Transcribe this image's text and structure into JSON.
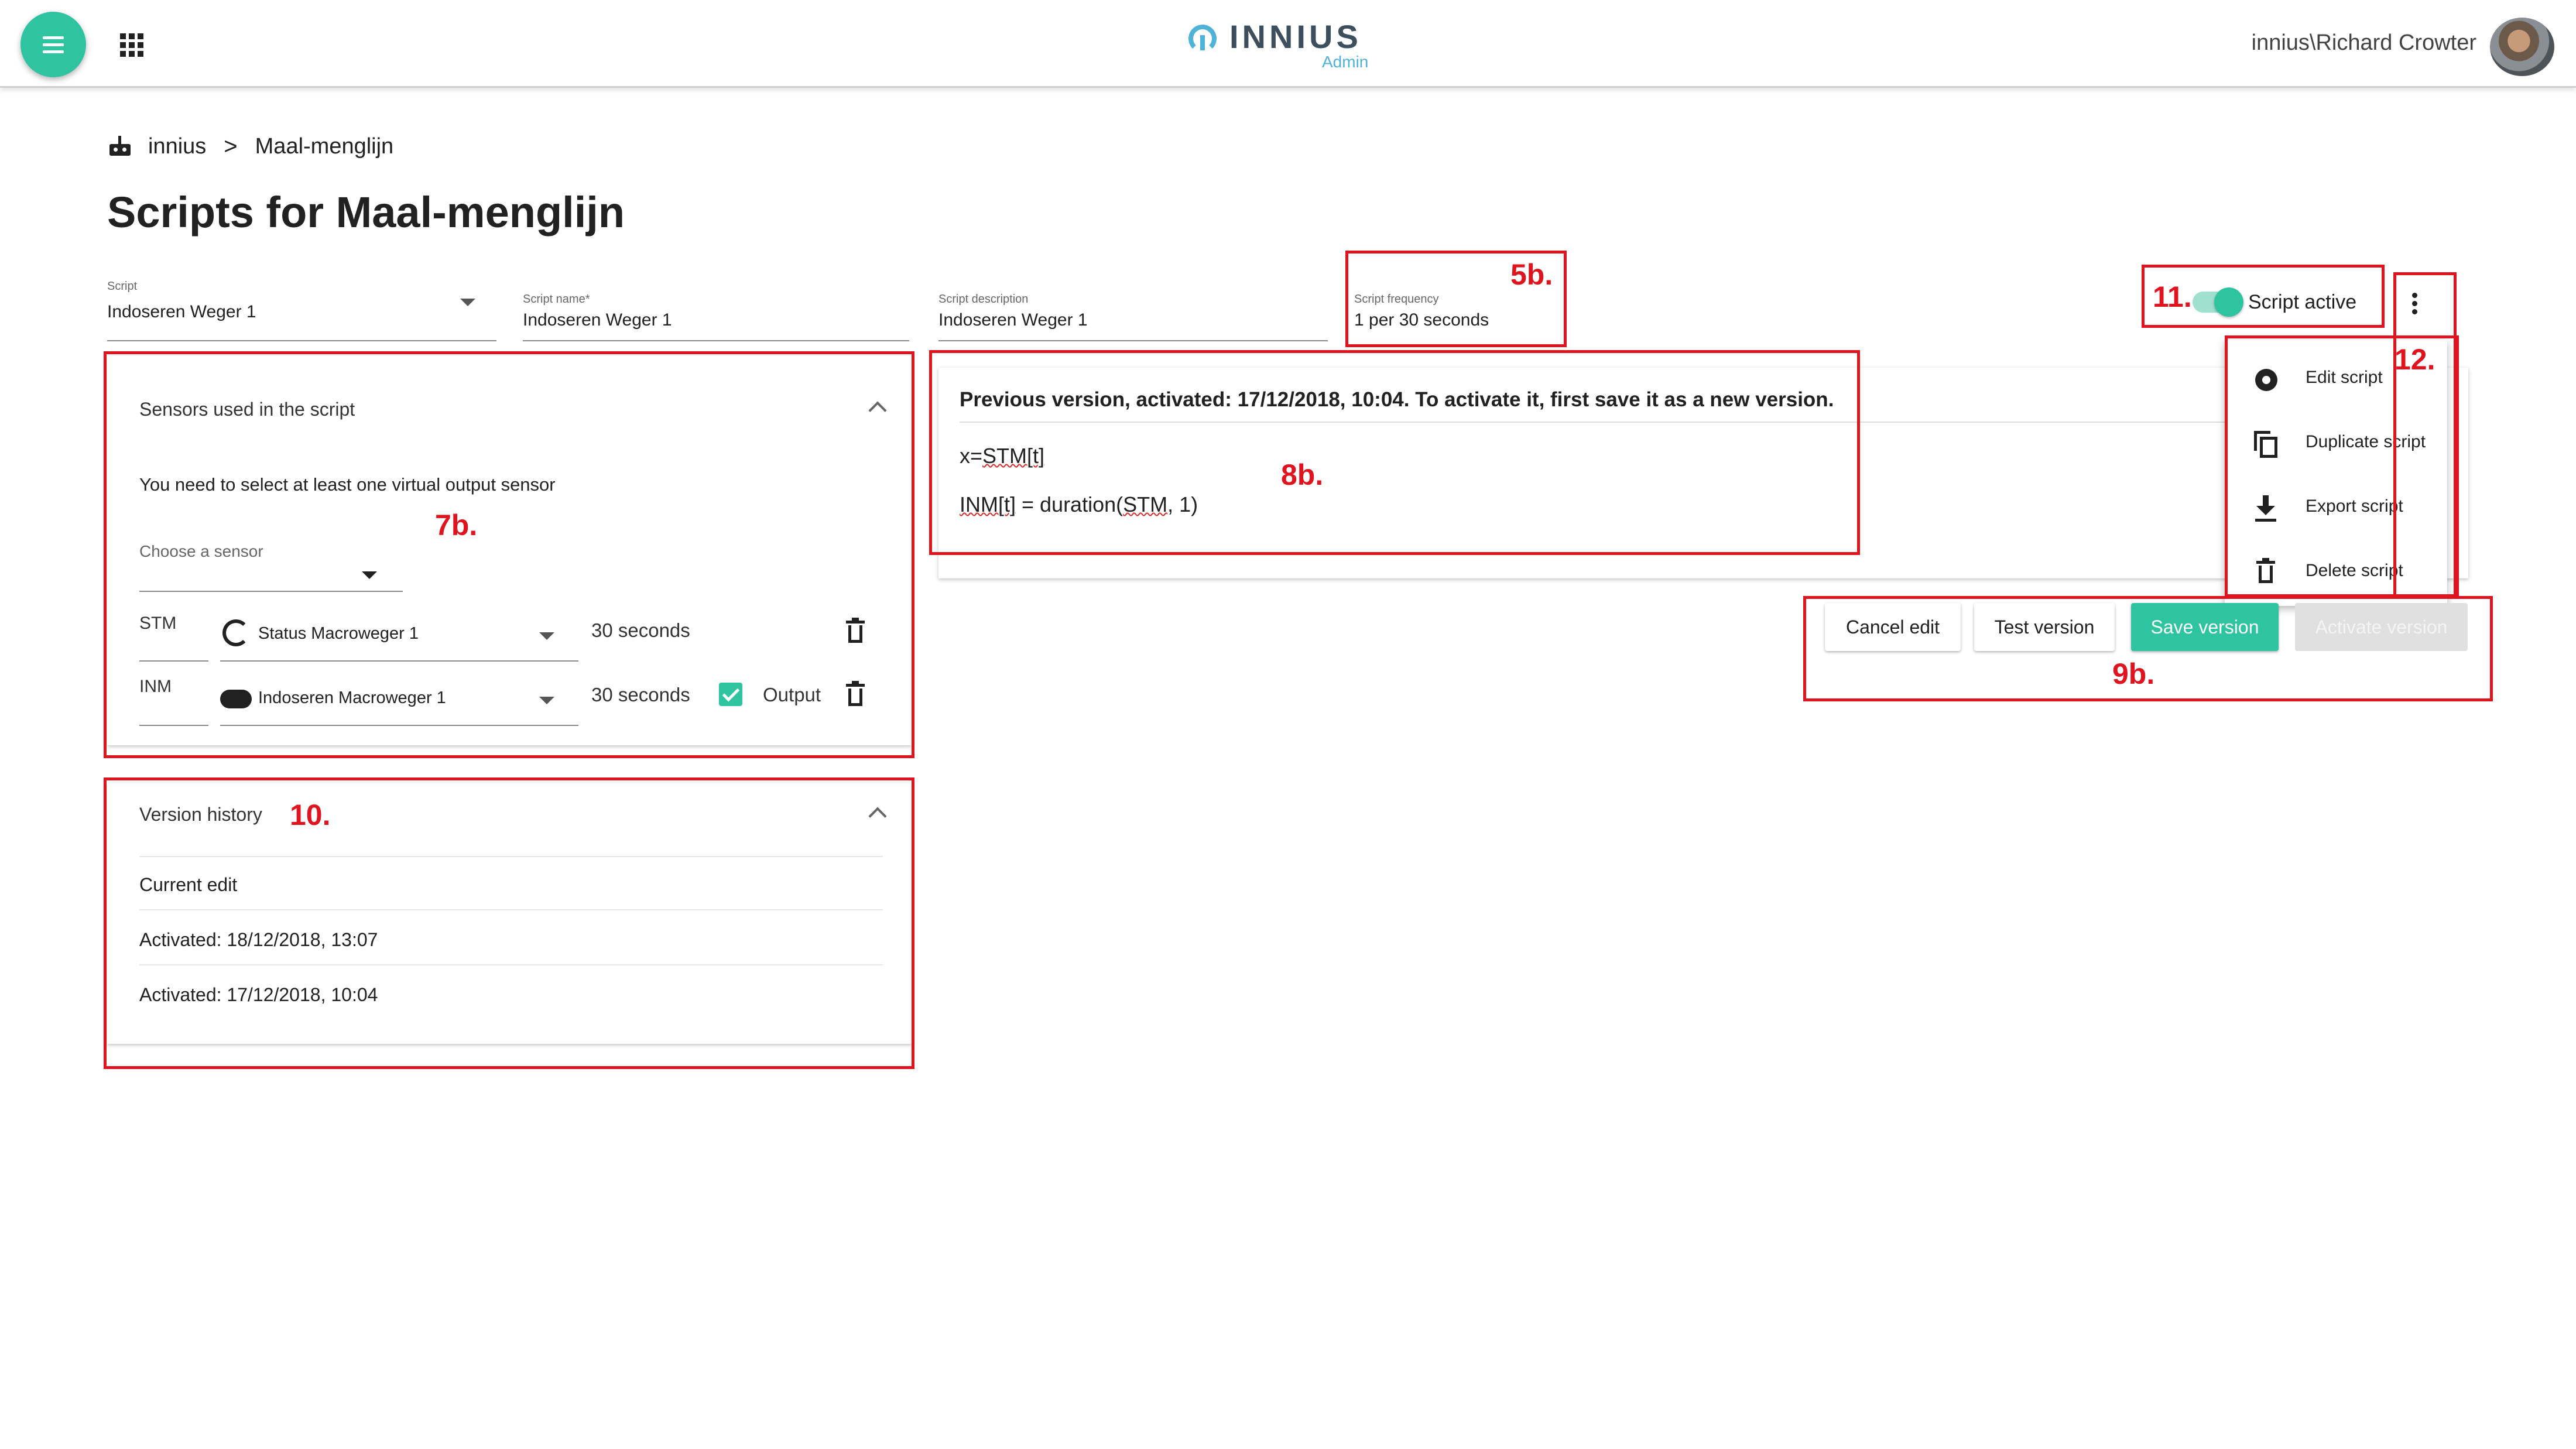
{
  "header": {
    "logo_name": "INNIUS",
    "logo_sub": "Admin",
    "username": "innius\\Richard Crowter"
  },
  "breadcrumb": {
    "root": "innius",
    "separator": ">",
    "current": "Maal-menglijn"
  },
  "page_title": "Scripts for Maal-menglijn",
  "form": {
    "script": {
      "label": "Script",
      "value": "Indoseren Weger 1"
    },
    "script_name": {
      "label": "Script name*",
      "value": "Indoseren Weger 1"
    },
    "script_description": {
      "label": "Script description",
      "value": "Indoseren Weger 1"
    },
    "script_frequency": {
      "label": "Script frequency",
      "value": "1 per 30 seconds"
    }
  },
  "toggle": {
    "label": "Script active",
    "on": true
  },
  "sensors_panel": {
    "title": "Sensors used in the script",
    "hint": "You need to select at least one virtual output sensor",
    "choose_label": "Choose a sensor",
    "rows": [
      {
        "code": "STM",
        "name": "Status Macroweger 1",
        "period": "30 seconds",
        "output": false
      },
      {
        "code": "INM",
        "name": "Indoseren Macroweger 1",
        "period": "30 seconds",
        "output": true,
        "output_label": "Output"
      }
    ]
  },
  "version_history": {
    "title": "Version history",
    "items": [
      "Current edit",
      "Activated: 18/12/2018, 13:07",
      "Activated: 17/12/2018, 10:04"
    ]
  },
  "code_panel": {
    "notice": "Previous version, activated: 17/12/2018, 10:04. To activate it, first save it as a new version.",
    "line1_prefix": "x=",
    "line1_flag": "STM[t]",
    "line2_flag": "INM[t]",
    "line2_mid": " = duration(",
    "line2_flag2": "STM",
    "line2_end": ", 1)"
  },
  "menu": {
    "items": [
      {
        "label": "Edit script",
        "icon": "gear-icon"
      },
      {
        "label": "Duplicate script",
        "icon": "copy-icon"
      },
      {
        "label": "Export script",
        "icon": "download-icon"
      },
      {
        "label": "Delete script",
        "icon": "trash-icon"
      }
    ]
  },
  "actions": {
    "cancel": "Cancel edit",
    "test": "Test version",
    "save": "Save version",
    "activate": "Activate version"
  },
  "annotations": {
    "a5b": "5b.",
    "a7b": "7b.",
    "a8b": "8b.",
    "a9b": "9b.",
    "a10": "10.",
    "a11": "11.",
    "a12": "12."
  },
  "colors": {
    "accent": "#2ec4a0",
    "annotation": "#e0141e",
    "logo": "#4fb3d9"
  }
}
